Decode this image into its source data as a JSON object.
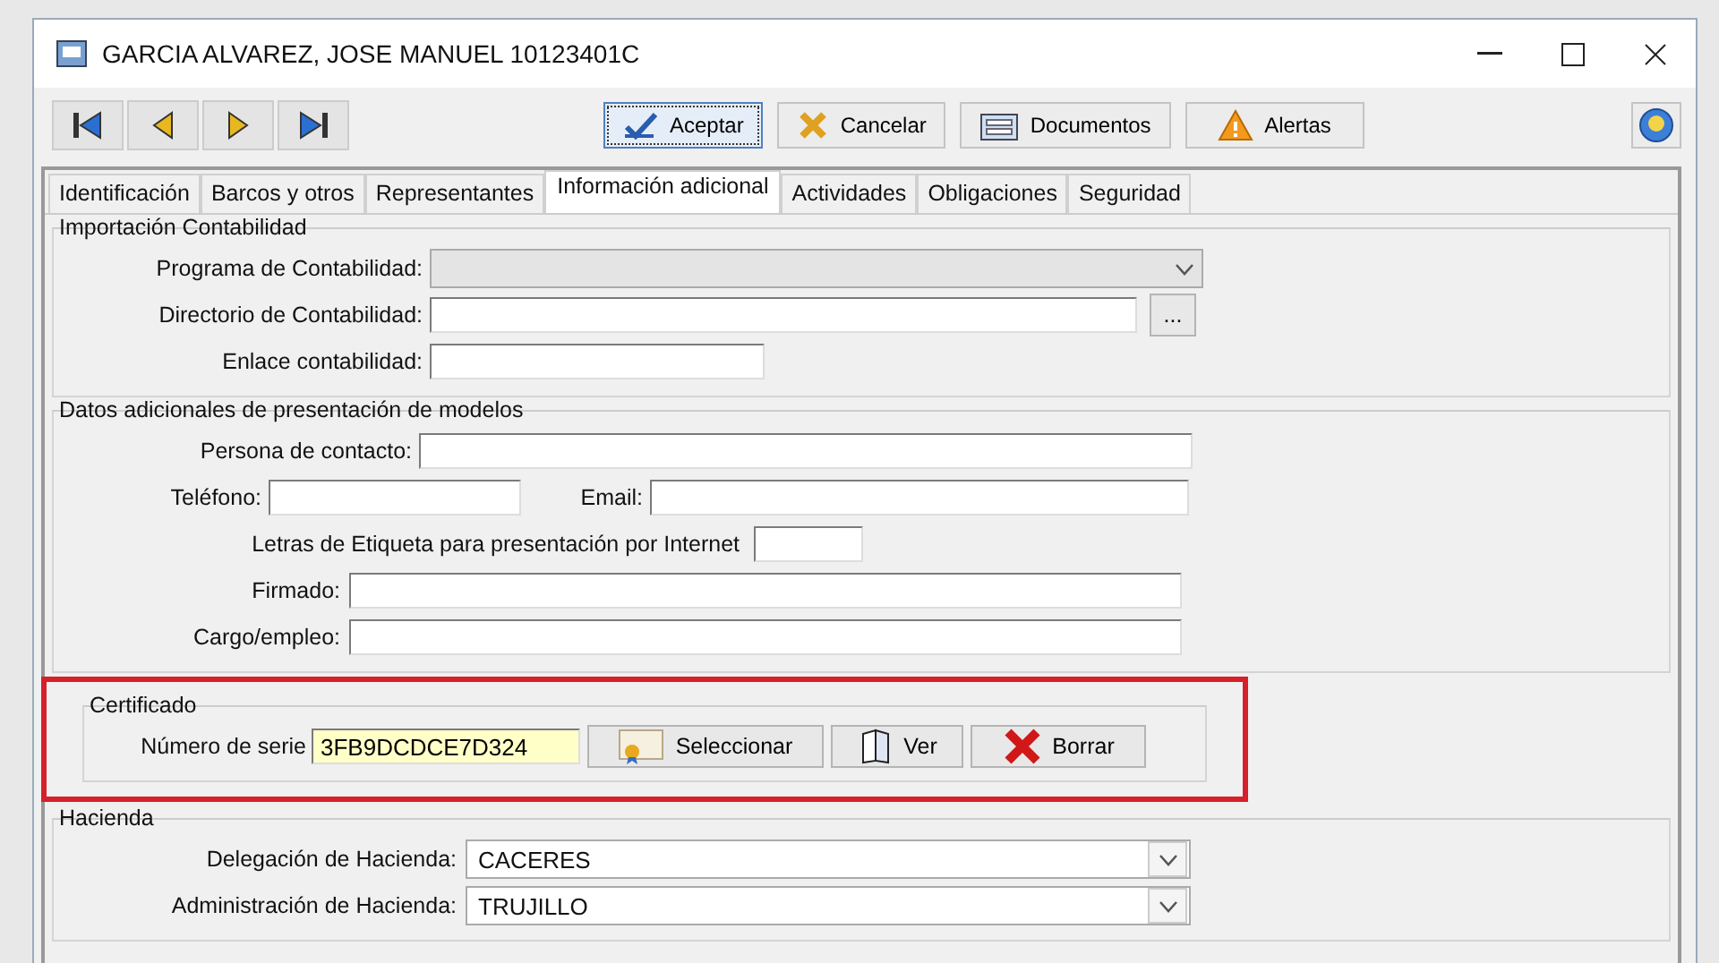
{
  "window": {
    "title": "GARCIA ALVAREZ, JOSE MANUEL  10123401C"
  },
  "nav_buttons": [
    {
      "kind": "first"
    },
    {
      "kind": "prev"
    },
    {
      "kind": "next"
    },
    {
      "kind": "last"
    }
  ],
  "toolbar": [
    {
      "kind": "accept",
      "label": "Aceptar",
      "focused": true
    },
    {
      "kind": "cancel",
      "label": "Cancelar",
      "focused": false
    },
    {
      "kind": "documents",
      "label": "Documentos",
      "focused": false
    },
    {
      "kind": "alerts",
      "label": "Alertas",
      "focused": false
    },
    {
      "kind": "help",
      "focused": false
    }
  ],
  "tabs": [
    {
      "label": "Identificación",
      "selected": false
    },
    {
      "label": "Barcos y otros",
      "selected": false
    },
    {
      "label": "Representantes",
      "selected": false
    },
    {
      "label": "Información adicional",
      "selected": true
    },
    {
      "label": "Actividades",
      "selected": false
    },
    {
      "label": "Obligaciones",
      "selected": false
    },
    {
      "label": "Seguridad",
      "selected": false
    }
  ],
  "groups": [
    {
      "title": "Importación Contabilidad",
      "highlighted": false,
      "rows": [
        [
          {
            "kind": "label",
            "text": "Programa de Contabilidad:"
          },
          {
            "kind": "combo",
            "disabled": true
          }
        ],
        [
          {
            "kind": "label",
            "text": "Directorio de Contabilidad:"
          },
          {
            "kind": "text"
          },
          {
            "kind": "button",
            "text": "..."
          }
        ],
        [
          {
            "kind": "label",
            "text": "Enlace contabilidad:"
          },
          {
            "kind": "text"
          }
        ]
      ]
    },
    {
      "title": "Datos adicionales de presentación de modelos",
      "highlighted": false,
      "rows": [
        [
          {
            "kind": "label",
            "text": "Persona de contacto:"
          },
          {
            "kind": "text"
          }
        ],
        [
          {
            "kind": "label",
            "text": "Teléfono:"
          },
          {
            "kind": "text"
          },
          {
            "kind": "label",
            "text": "Email:"
          },
          {
            "kind": "text"
          }
        ],
        [
          {
            "kind": "label",
            "text": "Letras de Etiqueta para presentación por Internet"
          },
          {
            "kind": "text"
          }
        ],
        [
          {
            "kind": "label",
            "text": "Firmado:"
          },
          {
            "kind": "text"
          }
        ],
        [
          {
            "kind": "label",
            "text": "Cargo/empleo:"
          },
          {
            "kind": "text"
          }
        ]
      ]
    },
    {
      "title": "Certificado",
      "highlighted": true,
      "rows": [
        [
          {
            "kind": "label",
            "text": "Número de serie"
          },
          {
            "kind": "text",
            "value": "3FB9DCDCE7D324",
            "highlight": true
          },
          {
            "kind": "select",
            "text": "Seleccionar"
          },
          {
            "kind": "view",
            "text": "Ver"
          },
          {
            "kind": "delete",
            "text": "Borrar"
          }
        ]
      ]
    },
    {
      "title": "Hacienda",
      "highlighted": false,
      "rows": [
        [
          {
            "kind": "label",
            "text": "Delegación de Hacienda:"
          },
          {
            "kind": "combo",
            "value": "CACERES",
            "disabled": false
          }
        ],
        [
          {
            "kind": "label",
            "text": "Administración de Hacienda:"
          },
          {
            "kind": "combo",
            "value": "TRUJILLO",
            "disabled": false
          }
        ]
      ]
    }
  ]
}
